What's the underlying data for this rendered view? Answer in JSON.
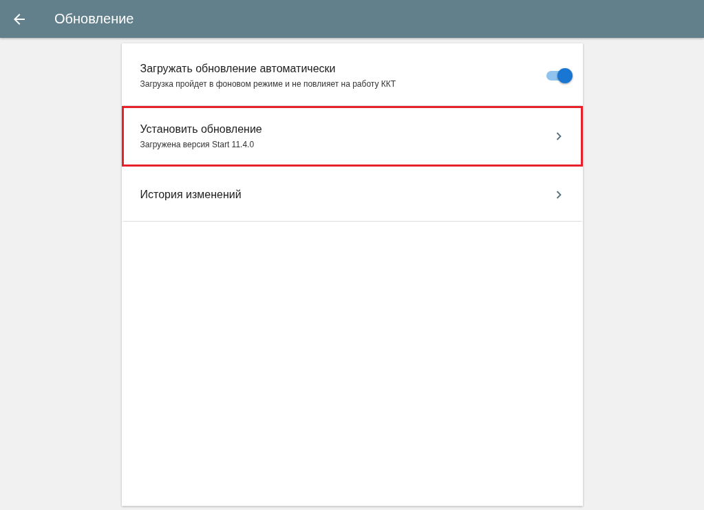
{
  "header": {
    "title": "Обновление"
  },
  "items": [
    {
      "kind": "toggle",
      "title": "Загружать обновление автоматически",
      "subtitle": "Загрузка пройдет в фоновом режиме и не повлияет на работу ККТ",
      "on": true,
      "highlighted": false
    },
    {
      "kind": "link",
      "title": "Установить обновление",
      "subtitle": "Загружена версия Start 11.4.0",
      "highlighted": true
    },
    {
      "kind": "link",
      "title": "История изменений",
      "highlighted": false
    }
  ]
}
